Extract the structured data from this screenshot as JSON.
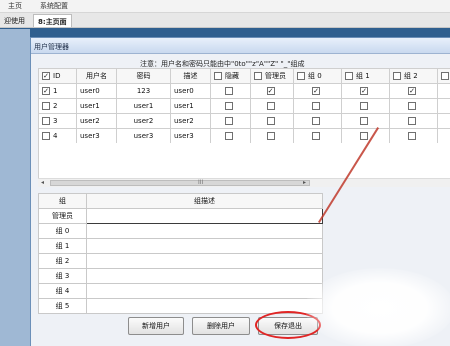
{
  "menu": {
    "home": "主页",
    "settings": "系统配置"
  },
  "tabs": [
    {
      "label": "迎使用"
    },
    {
      "label": "主页面",
      "prefix": "8",
      "active": true
    }
  ],
  "dialog": {
    "title": "用户管理器",
    "notice": "注意：用户名和密码只能由中\"0to\"\"z\"A\"\"Z\" \"_\"组成"
  },
  "user_table": {
    "columns": [
      "ID",
      "用户名",
      "密码",
      "描述",
      "隐藏",
      "管理员",
      "组 0",
      "组 1",
      "组 2"
    ],
    "rows": [
      {
        "id": "1",
        "checked": true,
        "username": "user0",
        "password": "123",
        "desc": "user0",
        "hidden": false,
        "admin": true,
        "g0": true,
        "g1": true,
        "g2": true
      },
      {
        "id": "2",
        "checked": false,
        "username": "user1",
        "password": "user1",
        "desc": "user1",
        "hidden": false,
        "admin": false,
        "g0": false,
        "g1": false,
        "g2": false
      },
      {
        "id": "3",
        "checked": false,
        "username": "user2",
        "password": "user2",
        "desc": "user2",
        "hidden": false,
        "admin": false,
        "g0": false,
        "g1": false,
        "g2": false
      },
      {
        "id": "4",
        "checked": false,
        "username": "user3",
        "password": "user3",
        "desc": "user3",
        "hidden": false,
        "admin": false,
        "g0": false,
        "g1": false,
        "g2": false
      }
    ]
  },
  "scrollbar": {
    "left_arrow": "◂",
    "right_arrow": "▸",
    "grip": "III"
  },
  "group_table": {
    "columns": [
      "组",
      "组描述"
    ],
    "rows": [
      "管理员",
      "组 0",
      "组 1",
      "组 2",
      "组 3",
      "组 4",
      "组 5"
    ]
  },
  "buttons": {
    "add": "新增用户",
    "delete": "删除用户",
    "save": "保存退出"
  },
  "colors": {
    "highlight": "#e02525",
    "background": "#2f5f8f"
  }
}
